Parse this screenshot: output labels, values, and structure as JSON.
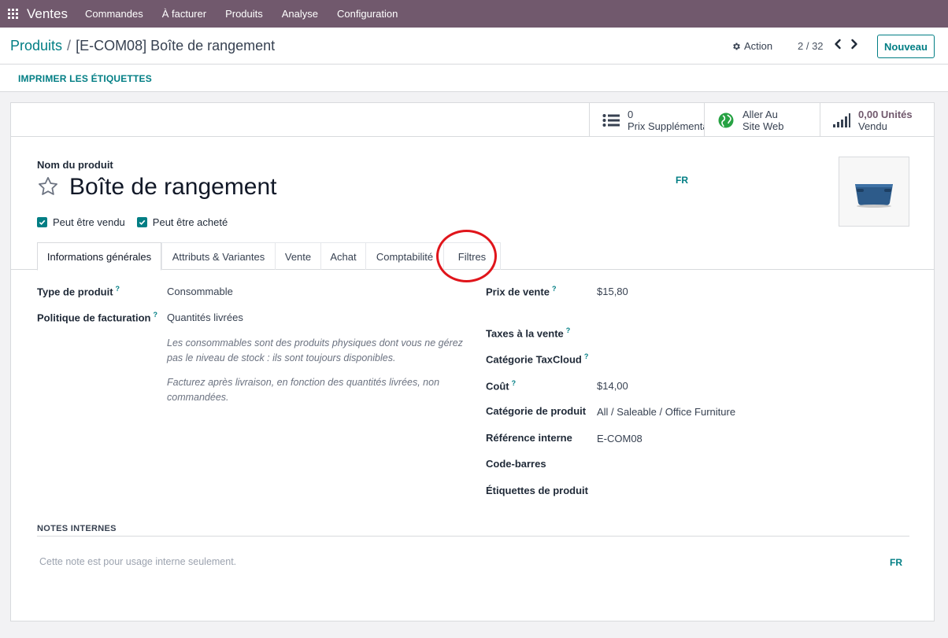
{
  "navbar": {
    "brand": "Ventes",
    "menu": [
      "Commandes",
      "À facturer",
      "Produits",
      "Analyse",
      "Configuration"
    ]
  },
  "control_panel": {
    "breadcrumb_root": "Produits",
    "breadcrumb_separator": "/",
    "breadcrumb_current": "[E-COM08] Boîte de rangement",
    "action_label": "Action",
    "pager": "2 / 32",
    "new_label": "Nouveau"
  },
  "status_bar": {
    "print_labels": "IMPRIMER LES ÉTIQUETTES"
  },
  "smart_buttons": [
    {
      "value": "0",
      "label": "Prix Supplémentaires",
      "icon": "list-icon"
    },
    {
      "value": "Aller Au",
      "label": "Site Web",
      "icon": "globe-icon"
    },
    {
      "value": "0,00 Unités",
      "label": "Vendu",
      "icon": "signal-bars-icon"
    }
  ],
  "product": {
    "name_label": "Nom du produit",
    "name": "Boîte de rangement",
    "lang": "FR",
    "can_be_sold": "Peut être vendu",
    "can_be_purchased": "Peut être acheté"
  },
  "tabs": [
    {
      "label": "Informations générales",
      "active": true
    },
    {
      "label": "Attributs & Variantes",
      "active": false
    },
    {
      "label": "Vente",
      "active": false
    },
    {
      "label": "Achat",
      "active": false
    },
    {
      "label": "Comptabilité",
      "active": false
    },
    {
      "label": "Filtres",
      "active": false
    }
  ],
  "left_fields": {
    "type_label": "Type de produit",
    "type_value": "Consommable",
    "invoice_policy_label": "Politique de facturation",
    "invoice_policy_value": "Quantités livrées",
    "help_1": "Les consommables sont des produits physiques dont vous ne gérez pas le niveau de stock : ils sont toujours disponibles.",
    "help_2": "Facturez après livraison, en fonction des quantités livrées, non commandées."
  },
  "right_fields": {
    "sale_price_label": "Prix de vente",
    "sale_price_value": "$15,80",
    "taxes_label": "Taxes à la vente",
    "taxcloud_label": "Catégorie TaxCloud",
    "cost_label": "Coût",
    "cost_value": "$14,00",
    "category_label": "Catégorie de produit",
    "category_value": "All / Saleable / Office Furniture",
    "ref_label": "Référence interne",
    "ref_value": "E-COM08",
    "barcode_label": "Code-barres",
    "tags_label": "Étiquettes de produit",
    "tooltip_mark": "?"
  },
  "notes": {
    "title": "NOTES INTERNES",
    "placeholder": "Cette note est pour usage interne seulement.",
    "lang": "FR"
  },
  "colors": {
    "navbar": "#71596d",
    "accent": "#017e84",
    "annotation": "#e0151b"
  }
}
